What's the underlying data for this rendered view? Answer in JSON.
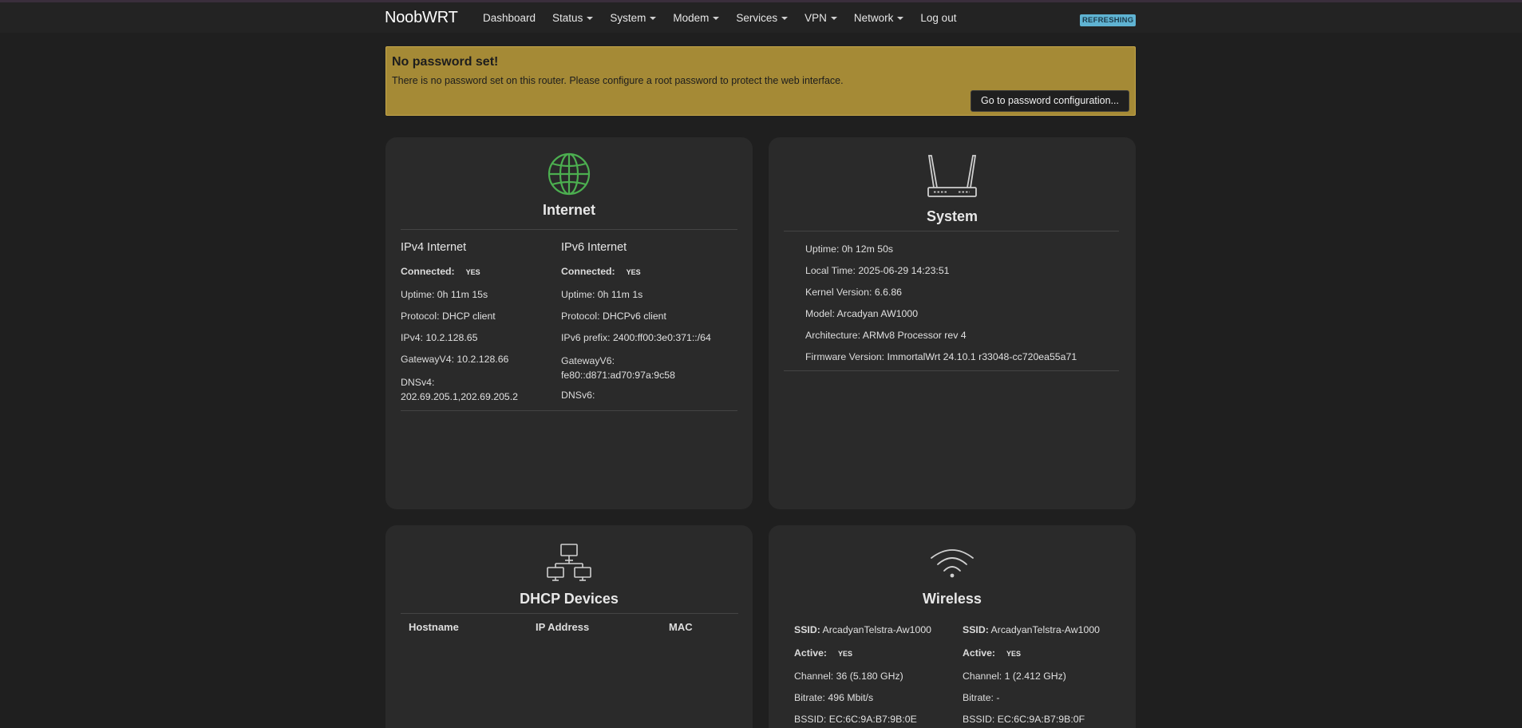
{
  "brand": "NoobWRT",
  "nav": [
    {
      "label": "Dashboard",
      "dropdown": false
    },
    {
      "label": "Status",
      "dropdown": true
    },
    {
      "label": "System",
      "dropdown": true
    },
    {
      "label": "Modem",
      "dropdown": true
    },
    {
      "label": "Services",
      "dropdown": true
    },
    {
      "label": "VPN",
      "dropdown": true
    },
    {
      "label": "Network",
      "dropdown": true
    },
    {
      "label": "Log out",
      "dropdown": false
    }
  ],
  "status_badge": "REFRESHING",
  "alert": {
    "title": "No password set!",
    "text": "There is no password set on this router. Please configure a root password to protect the web interface.",
    "button": "Go to password configuration..."
  },
  "internet": {
    "title": "Internet",
    "ipv4": {
      "heading": "IPv4 Internet",
      "connected_label": "Connected:",
      "connected_value": "YES",
      "uptime_label": "Uptime:",
      "uptime_value": "0h 11m 15s",
      "protocol_label": "Protocol:",
      "protocol_value": "DHCP client",
      "ip_label": "IPv4:",
      "ip_value": "10.2.128.65",
      "gateway_label": "GatewayV4:",
      "gateway_value": "10.2.128.66",
      "dns_label": "DNSv4:",
      "dns_value": "202.69.205.1,202.69.205.2"
    },
    "ipv6": {
      "heading": "IPv6 Internet",
      "connected_label": "Connected:",
      "connected_value": "YES",
      "uptime_label": "Uptime:",
      "uptime_value": "0h 11m 1s",
      "protocol_label": "Protocol:",
      "protocol_value": "DHCPv6 client",
      "prefix_label": "IPv6 prefix:",
      "prefix_value": "2400:ff00:3e0:371::/64",
      "gateway_label": "GatewayV6:",
      "gateway_value": "fe80::d871:ad70:97a:9c58",
      "dns_label": "DNSv6:",
      "dns_value": ""
    }
  },
  "system": {
    "title": "System",
    "uptime_label": "Uptime:",
    "uptime_value": "0h 12m 50s",
    "localtime_label": "Local Time:",
    "localtime_value": "2025-06-29 14:23:51",
    "kernel_label": "Kernel Version:",
    "kernel_value": "6.6.86",
    "model_label": "Model:",
    "model_value": "Arcadyan AW1000",
    "arch_label": "Architecture:",
    "arch_value": "ARMv8 Processor rev 4",
    "firmware_label": "Firmware Version:",
    "firmware_value": "ImmortalWrt 24.10.1 r33048-cc720ea55a71"
  },
  "dhcp": {
    "title": "DHCP Devices",
    "columns": [
      "Hostname",
      "IP Address",
      "MAC"
    ]
  },
  "wireless": {
    "title": "Wireless",
    "radios": [
      {
        "ssid_label": "SSID:",
        "ssid_value": "ArcadyanTelstra-Aw1000",
        "active_label": "Active:",
        "active_value": "YES",
        "channel_label": "Channel:",
        "channel_value": "36 (5.180 GHz)",
        "bitrate_label": "Bitrate:",
        "bitrate_value": "496 Mbit/s",
        "bssid_label": "BSSID:",
        "bssid_value": "EC:6C:9A:B7:9B:0E"
      },
      {
        "ssid_label": "SSID:",
        "ssid_value": "ArcadyanTelstra-Aw1000",
        "active_label": "Active:",
        "active_value": "YES",
        "channel_label": "Channel:",
        "channel_value": "1 (2.412 GHz)",
        "bitrate_label": "Bitrate:",
        "bitrate_value": "-",
        "bssid_label": "BSSID:",
        "bssid_value": "EC:6C:9A:B7:9B:0F"
      }
    ]
  },
  "colors": {
    "background": "#1f1f1f",
    "card": "#2a2a2a",
    "alert": "#a58a36",
    "badge": "#5fb3d2",
    "globe": "#4caf50"
  }
}
